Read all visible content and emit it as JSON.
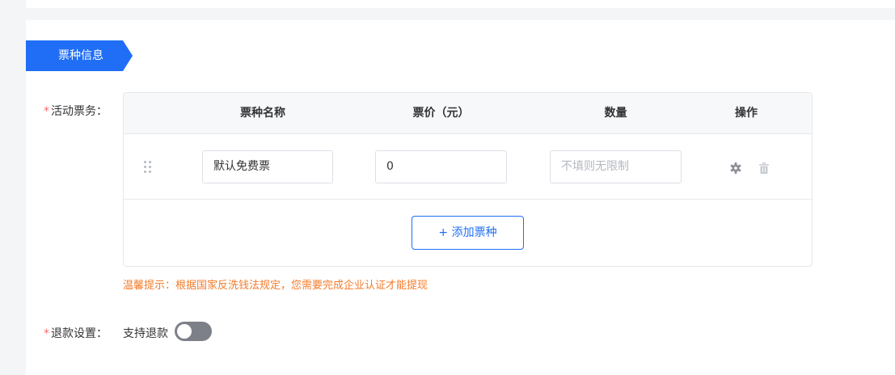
{
  "section": {
    "title": "票种信息"
  },
  "tickets_field": {
    "required_mark": "*",
    "label": "活动票务："
  },
  "table": {
    "headers": [
      "票种名称",
      "票价（元）",
      "数量",
      "操作"
    ],
    "rows": [
      {
        "name": "默认免费票",
        "price": "0",
        "quantity_placeholder": "不填则无限制"
      }
    ],
    "add_button": "+ 添加票种"
  },
  "tip": "温馨提示：根据国家反洗钱法规定，您需要完成企业认证才能提现",
  "refund_field": {
    "required_mark": "*",
    "label": "退款设置：",
    "toggle_label": "支持退款",
    "toggle_on": false
  },
  "colors": {
    "accent": "#1f6ef5",
    "warning": "#f47c2b",
    "required": "#f56c6c"
  },
  "icons": [
    "drag-handle-icon",
    "gear-icon",
    "trash-icon"
  ]
}
